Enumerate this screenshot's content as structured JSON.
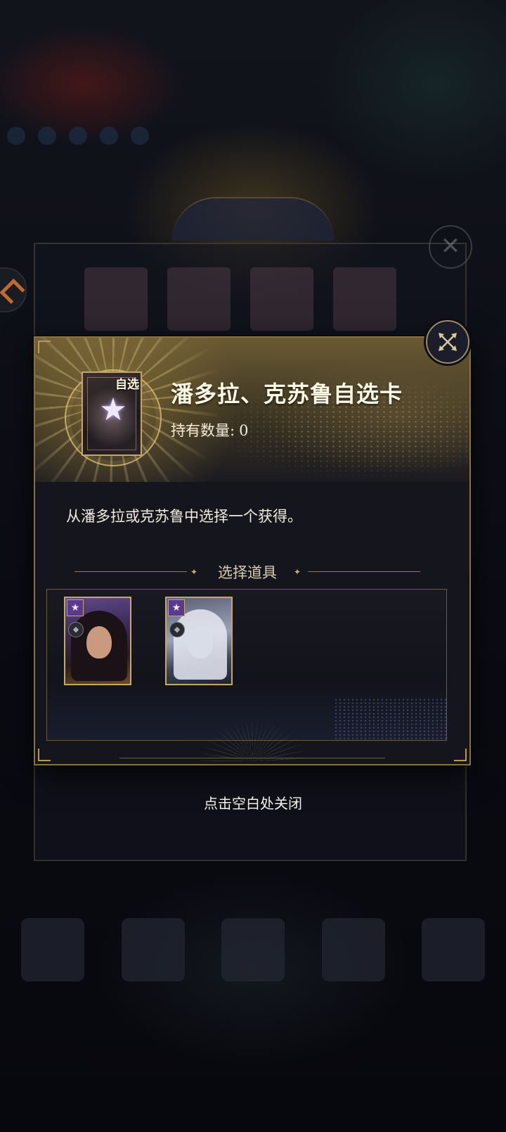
{
  "dialog": {
    "item_title": "潘多拉、克苏鲁自选卡",
    "item_tag": "自选",
    "owned_label": "持有数量:",
    "owned_count": "0",
    "description": "从潘多拉或克苏鲁中选择一个获得。",
    "section_title": "选择道具",
    "choices": [
      {
        "rank_icon": "star-badge-icon",
        "type_icon": "element-icon"
      },
      {
        "rank_icon": "star-badge-icon",
        "type_icon": "element-icon"
      }
    ],
    "close_icon": "close-icon"
  },
  "hint": {
    "close_text": "点击空白处关闭"
  },
  "colors": {
    "gold_border": "#8a7140",
    "gold_accent": "#c9a85c",
    "panel_bg": "#15151d",
    "rank_purple": "#5a3a8c"
  }
}
